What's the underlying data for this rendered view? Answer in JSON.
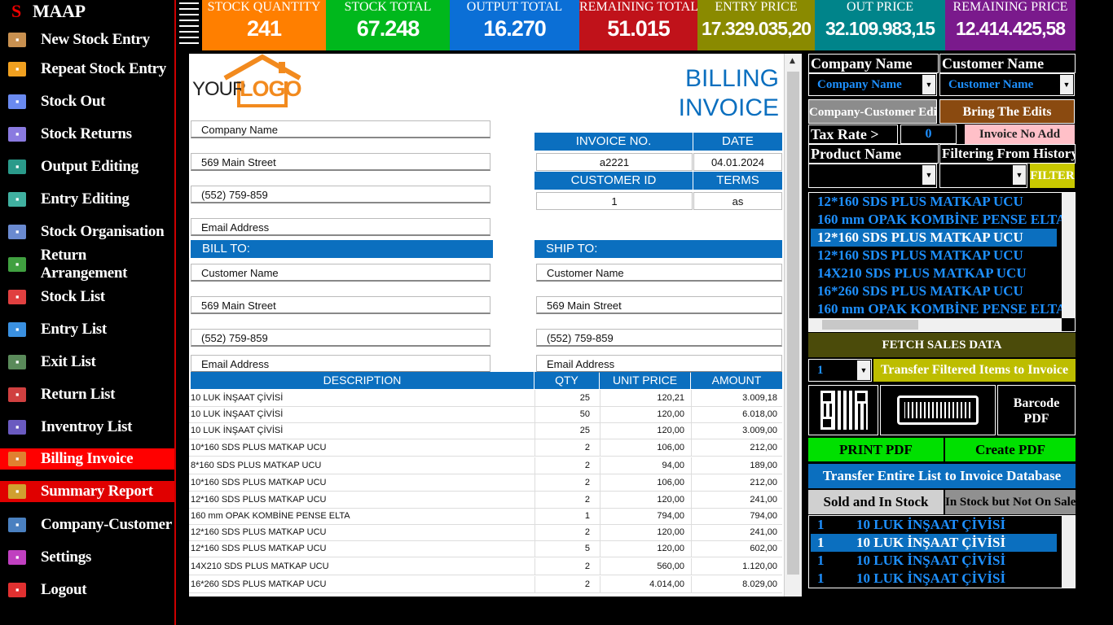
{
  "sidebar": {
    "brand_letter": "S",
    "brand": "MAAP",
    "items": [
      {
        "label": "New Stock Entry",
        "icon": "new-stock-entry-icon"
      },
      {
        "label": "Repeat Stock Entry",
        "icon": "repeat-stock-entry-icon"
      },
      {
        "label": "Stock Out",
        "icon": "stock-out-icon"
      },
      {
        "label": "Stock Returns",
        "icon": "stock-returns-icon"
      },
      {
        "label": "Output Editing",
        "icon": "output-editing-icon"
      },
      {
        "label": "Entry Editing",
        "icon": "entry-editing-icon"
      },
      {
        "label": "Stock Organisation",
        "icon": "stock-organisation-icon"
      },
      {
        "label": "Return Arrangement",
        "icon": "return-arrangement-icon"
      },
      {
        "label": "Stock List",
        "icon": "stock-list-icon"
      },
      {
        "label": "Entry List",
        "icon": "entry-list-icon"
      },
      {
        "label": "Exit List",
        "icon": "exit-list-icon"
      },
      {
        "label": "Return List",
        "icon": "return-list-icon"
      },
      {
        "label": "Inventroy List",
        "icon": "inventory-list-icon"
      },
      {
        "label": "Billing Invoice",
        "icon": "billing-invoice-icon"
      },
      {
        "label": "Summary Report",
        "icon": "summary-report-icon"
      },
      {
        "label": "Company-Customer",
        "icon": "company-customer-icon"
      },
      {
        "label": "Settings",
        "icon": "settings-icon"
      },
      {
        "label": "Logout",
        "icon": "logout-icon"
      }
    ]
  },
  "kpis": [
    {
      "title": "STOCK QUANTITY",
      "value": "241",
      "color": "#ff7f00"
    },
    {
      "title": "STOCK TOTAL",
      "value": "67.248",
      "color": "#00b81c"
    },
    {
      "title": "OUTPUT TOTAL",
      "value": "16.270",
      "color": "#0b6fd6"
    },
    {
      "title": "REMAINING TOTAL",
      "value": "51.015",
      "color": "#c0121a"
    },
    {
      "title": "ENTRY PRICE",
      "value": "17.329.035,20",
      "color": "#8a8a00"
    },
    {
      "title": "OUT PRICE",
      "value": "32.109.983,15",
      "color": "#00848a"
    },
    {
      "title": "REMAINING PRICE",
      "value": "12.414.425,58",
      "color": "#7a1a8c"
    }
  ],
  "invoice": {
    "logo_your": "YOUR",
    "logo_logo": "LOGO",
    "title1": "BILLING",
    "title2": "INVOICE",
    "company": {
      "name": "Company Name",
      "street": "569 Main Street",
      "phone": "(552) 759-859",
      "email": "Email Address"
    },
    "invoice_no_label": "INVOICE NO.",
    "date_label": "DATE",
    "invoice_no": "a2221",
    "date": "04.01.2024",
    "customer_id_label": "CUSTOMER ID",
    "terms_label": "TERMS",
    "customer_id": "1",
    "terms": "as",
    "bill_to_label": "BILL TO:",
    "ship_to_label": "SHIP TO:",
    "bill_to": {
      "name": "Customer Name",
      "street": "569 Main Street",
      "phone": "(552) 759-859",
      "email": "Email Address"
    },
    "ship_to": {
      "name": "Customer Name",
      "street": "569 Main Street",
      "phone": "(552) 759-859",
      "email": "Email Address"
    },
    "columns": {
      "description": "DESCRIPTION",
      "qty": "QTY",
      "unit_price": "UNIT PRICE",
      "amount": "AMOUNT"
    },
    "rows": [
      {
        "d": "10 LUK İNŞAAT ÇİVİSİ",
        "q": "25",
        "u": "120,21",
        "a": "3.009,18"
      },
      {
        "d": "10 LUK İNŞAAT ÇİVİSİ",
        "q": "50",
        "u": "120,00",
        "a": "6.018,00"
      },
      {
        "d": "10 LUK İNŞAAT ÇİVİSİ",
        "q": "25",
        "u": "120,00",
        "a": "3.009,00"
      },
      {
        "d": "10*160 SDS PLUS MATKAP UCU",
        "q": "2",
        "u": "106,00",
        "a": "212,00"
      },
      {
        "d": "8*160 SDS PLUS MATKAP UCU",
        "q": "2",
        "u": "94,00",
        "a": "189,00"
      },
      {
        "d": "10*160 SDS PLUS MATKAP UCU",
        "q": "2",
        "u": "106,00",
        "a": "212,00"
      },
      {
        "d": "12*160 SDS PLUS MATKAP UCU",
        "q": "2",
        "u": "120,00",
        "a": "241,00"
      },
      {
        "d": "160 mm OPAK KOMBİNE PENSE ELTA",
        "q": "1",
        "u": "794,00",
        "a": "794,00"
      },
      {
        "d": "12*160 SDS PLUS MATKAP UCU",
        "q": "2",
        "u": "120,00",
        "a": "241,00"
      },
      {
        "d": "12*160 SDS PLUS MATKAP UCU",
        "q": "5",
        "u": "120,00",
        "a": "602,00"
      },
      {
        "d": "14X210 SDS PLUS MATKAP UCU",
        "q": "2",
        "u": "560,00",
        "a": "1.120,00"
      },
      {
        "d": "16*260 SDS PLUS MATKAP UCU",
        "q": "2",
        "u": "4.014,00",
        "a": "8.029,00"
      }
    ]
  },
  "right": {
    "company_name_label": "Company Name",
    "customer_name_label": "Customer Name",
    "company_combo": "Company Name",
    "customer_combo": "Customer Name",
    "company_customer_edit": "Company-Customer Edit",
    "bring_edits": "Bring The Edits",
    "tax_rate_label": "Tax Rate >",
    "tax_rate": "0",
    "invoice_no_add": "Invoice No Add",
    "product_name_label": "Product Name",
    "filtering_label": "Filtering From History",
    "filter": "FILTER",
    "products": [
      "12*160 SDS PLUS MATKAP UCU",
      "160 mm OPAK KOMBİNE PENSE ELTA",
      "12*160 SDS PLUS MATKAP UCU",
      "12*160 SDS PLUS MATKAP UCU",
      "14X210 SDS PLUS MATKAP UCU",
      "16*260 SDS PLUS MATKAP UCU",
      "160 mm OPAK KOMBİNE PENSE ELTA"
    ],
    "fetch_sales": "FETCH SALES DATA",
    "qty_combo": "1",
    "transfer_filtered": "Transfer Filtered Items to Invoice",
    "barcode_pdf_1": "Barcode",
    "barcode_pdf_2": "PDF",
    "print_pdf": "PRINT PDF",
    "create_pdf": "Create PDF",
    "transfer_entire": "Transfer Entire List to Invoice Database",
    "sold_in_stock": "Sold and In Stock",
    "in_stock_not_sale": "In Stock but Not On Sale",
    "stock_items": [
      {
        "q": "1",
        "n": "10 LUK İNŞAAT ÇİVİSİ"
      },
      {
        "q": "1",
        "n": "10 LUK İNŞAAT ÇİVİSİ"
      },
      {
        "q": "1",
        "n": "10 LUK İNŞAAT ÇİVİSİ"
      },
      {
        "q": "1",
        "n": "10 LUK İNŞAAT ÇİVİSİ"
      }
    ]
  }
}
